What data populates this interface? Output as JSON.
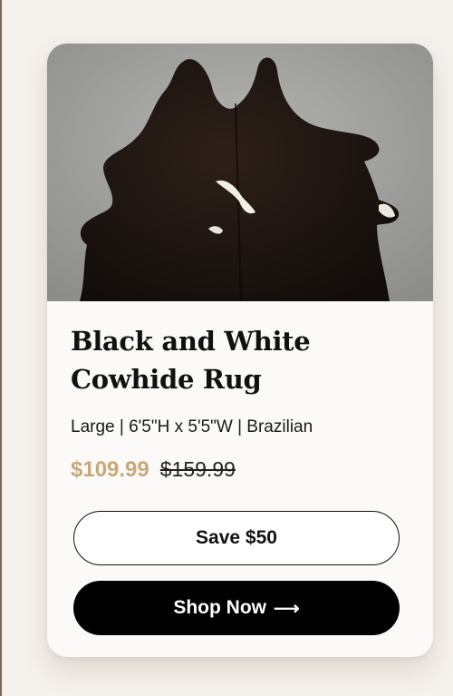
{
  "product": {
    "image_alt": "Black and white cowhide rug",
    "title": "Black and White Cowhide Rug",
    "subtitle": "Large | 6'5\"H x 5'5\"W | Brazilian",
    "sale_price": "$109.99",
    "original_price": "$159.99"
  },
  "actions": {
    "save_label": "Save $50",
    "shop_label": "Shop Now",
    "shop_icon": "arrow-right-icon"
  },
  "colors": {
    "page_bg": "#f5f1ec",
    "card_bg": "#fbfaf8",
    "sale_price": "#c9a97a",
    "primary_button": "#000000"
  }
}
